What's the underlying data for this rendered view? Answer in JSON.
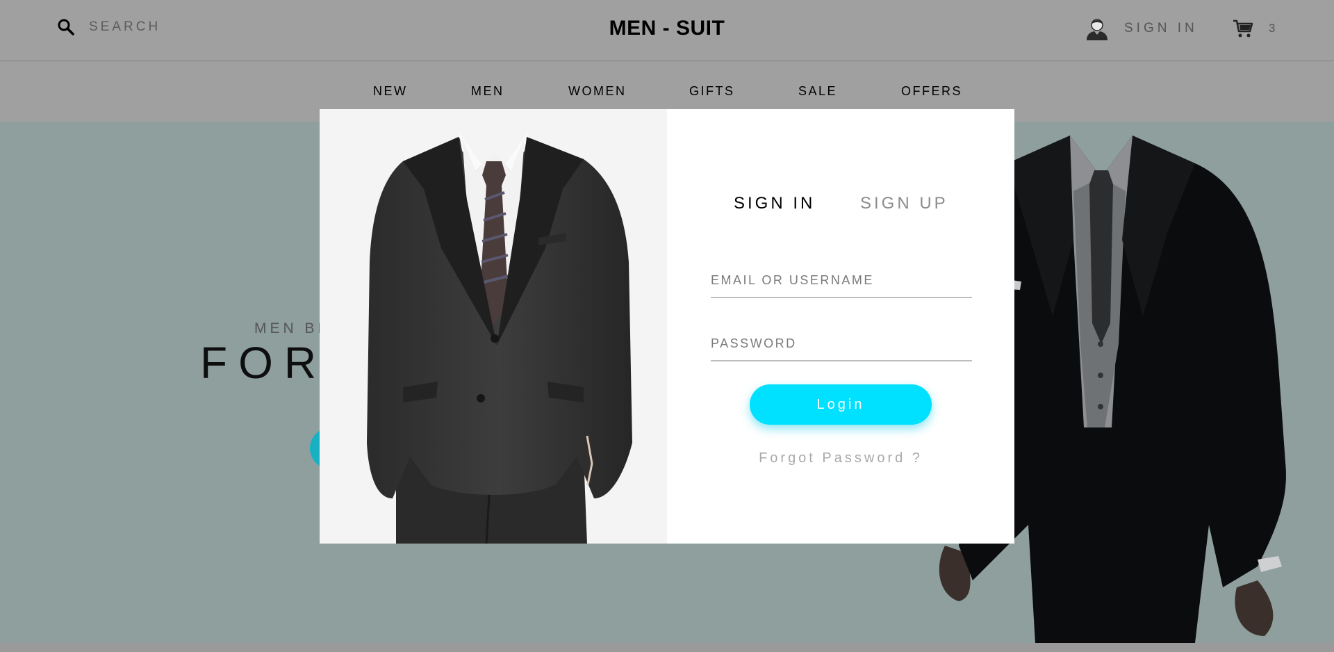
{
  "header": {
    "search_placeholder": "SEARCH",
    "brand": "MEN - SUIT",
    "signin_label": "SIGN IN",
    "cart_count": "3"
  },
  "nav": {
    "items": [
      {
        "label": "NEW"
      },
      {
        "label": "MEN"
      },
      {
        "label": "WOMEN"
      },
      {
        "label": "GIFTS"
      },
      {
        "label": "SALE"
      },
      {
        "label": "OFFERS"
      }
    ]
  },
  "hero": {
    "eyebrow": "MEN BL",
    "title": "FOR"
  },
  "modal": {
    "tabs": {
      "active": "SIGN IN",
      "inactive": "SIGN UP"
    },
    "email_placeholder": "EMAIL OR USERNAME",
    "password_placeholder": "PASSWORD",
    "login_label": "Login",
    "forgot_label": "Forgot Password ?"
  },
  "icons": {
    "search": "search-icon",
    "user": "user-icon",
    "cart": "cart-icon"
  },
  "colors": {
    "accent": "#00e0ff",
    "overlay": "#9a9a9a",
    "hero_bg": "#8e9f9e"
  }
}
